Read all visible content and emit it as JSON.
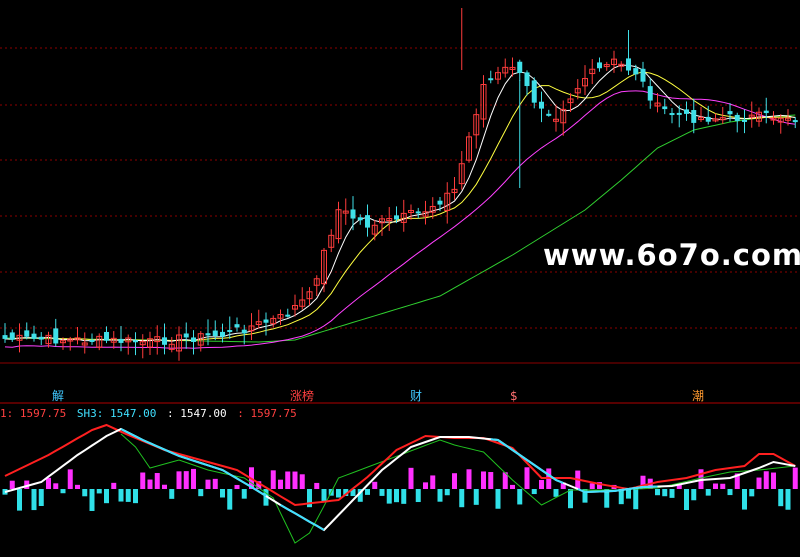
{
  "watermark": "www.6o7o.com",
  "markers": [
    {
      "text": "解",
      "color": "#40c8ff"
    },
    {
      "text": "涨榜",
      "color": "#ff4040"
    },
    {
      "text": "财",
      "color": "#40c8ff"
    },
    {
      "text": "$",
      "color": "#ff7070"
    },
    {
      "text": "潮",
      "color": "#ff9a30"
    }
  ],
  "indicator_labels": [
    {
      "text": "1: 1597.75",
      "color": "#ff4040"
    },
    {
      "text": "SH3: 1547.00",
      "color": "#40e0ff"
    },
    {
      "text": ": 1547.00",
      "color": "#ffffff"
    },
    {
      "text": ": 1597.75",
      "color": "#ff4040"
    }
  ],
  "colors": {
    "background": "#000000",
    "grid": "#8b0000",
    "divider": "#b00000",
    "up_candle": "#ff3c3c",
    "down_candle": "#40e0e8",
    "ma_white": "#ffffff",
    "ma_yellow": "#ffff40",
    "ma_magenta": "#ff40ff",
    "ma_green": "#30d030",
    "ind_red": "#ff2020",
    "ind_white": "#ffffff",
    "ind_cyan": "#40e0ff",
    "ind_green": "#20c020",
    "bar_magenta": "#ff30ff",
    "bar_cyan": "#30e0e8"
  },
  "chart_data": [
    {
      "type": "candlestick",
      "count": 110,
      "gridlines": "dotted horizontal",
      "overlays": [
        "MA white",
        "MA yellow",
        "MA magenta",
        "MA green"
      ],
      "note_trend": [
        [
          0,
          339
        ],
        [
          10,
          340
        ],
        [
          20,
          342
        ],
        [
          25,
          338
        ],
        [
          30,
          335
        ],
        [
          38,
          318
        ],
        [
          42,
          296
        ],
        [
          46,
          210
        ],
        [
          50,
          225
        ],
        [
          54,
          220
        ],
        [
          58,
          210
        ],
        [
          62,
          190
        ],
        [
          66,
          85
        ],
        [
          70,
          65
        ],
        [
          73,
          100
        ],
        [
          76,
          115
        ],
        [
          80,
          78
        ],
        [
          84,
          62
        ],
        [
          87,
          72
        ],
        [
          90,
          108
        ],
        [
          94,
          118
        ],
        [
          98,
          118
        ],
        [
          102,
          118
        ],
        [
          106,
          116
        ],
        [
          109,
          117
        ]
      ]
    },
    {
      "type": "line+bar",
      "count": 110,
      "series": [
        {
          "role": "red-white",
          "points": [
            [
              0,
              492
            ],
            [
              5,
              482
            ],
            [
              10,
              455
            ],
            [
              14,
              436
            ],
            [
              16,
              429
            ],
            [
              19,
              440
            ],
            [
              24,
              456
            ],
            [
              30,
              470
            ],
            [
              34,
              487
            ],
            [
              38,
              505
            ],
            [
              44,
              530
            ],
            [
              48,
              500
            ],
            [
              52,
              470
            ],
            [
              56,
              447
            ],
            [
              60,
              437
            ],
            [
              64,
              437
            ],
            [
              68,
              440
            ],
            [
              72,
              460
            ],
            [
              76,
              480
            ],
            [
              80,
              492
            ],
            [
              84,
              491
            ],
            [
              88,
              487
            ],
            [
              92,
              486
            ],
            [
              96,
              480
            ],
            [
              100,
              478
            ],
            [
              104,
              468
            ],
            [
              106,
              462
            ],
            [
              109,
              466
            ]
          ]
        },
        {
          "role": "red-high",
          "points": [
            [
              0,
              476
            ],
            [
              6,
              455
            ],
            [
              12,
              430
            ],
            [
              14,
              425
            ],
            [
              17,
              435
            ],
            [
              22,
              450
            ],
            [
              32,
              470
            ],
            [
              40,
              505
            ],
            [
              46,
              500
            ],
            [
              50,
              477
            ],
            [
              54,
              450
            ],
            [
              58,
              436
            ],
            [
              62,
              438
            ],
            [
              66,
              438
            ],
            [
              70,
              448
            ],
            [
              74,
              478
            ],
            [
              78,
              478
            ],
            [
              82,
              484
            ],
            [
              86,
              489
            ],
            [
              90,
              482
            ],
            [
              94,
              478
            ],
            [
              98,
              470
            ],
            [
              102,
              466
            ],
            [
              104,
              454
            ],
            [
              106,
              454
            ],
            [
              109,
              466
            ]
          ]
        },
        {
          "role": "green",
          "points": [
            [
              16,
              434
            ],
            [
              18,
              447
            ],
            [
              20,
              468
            ],
            [
              24,
              460
            ],
            [
              28,
              470
            ],
            [
              33,
              478
            ],
            [
              37,
              498
            ],
            [
              40,
              543
            ],
            [
              42,
              533
            ],
            [
              44,
              506
            ],
            [
              46,
              478
            ],
            [
              60,
              440
            ],
            [
              62,
              445
            ],
            [
              66,
              452
            ],
            [
              70,
              480
            ],
            [
              74,
              505
            ],
            [
              78,
              490
            ],
            [
              84,
              490
            ],
            [
              90,
              488
            ],
            [
              96,
              478
            ],
            [
              100,
              472
            ],
            [
              104,
              470
            ],
            [
              109,
              466
            ]
          ]
        },
        {
          "role": "cyan",
          "ranges": [
            [
              16,
              36
            ],
            [
              38,
              44
            ],
            [
              67,
              77
            ],
            [
              79,
              90
            ]
          ]
        }
      ],
      "histogram": {
        "baseline": 489,
        "up_color": "magenta",
        "down_color": "cyan"
      }
    }
  ]
}
